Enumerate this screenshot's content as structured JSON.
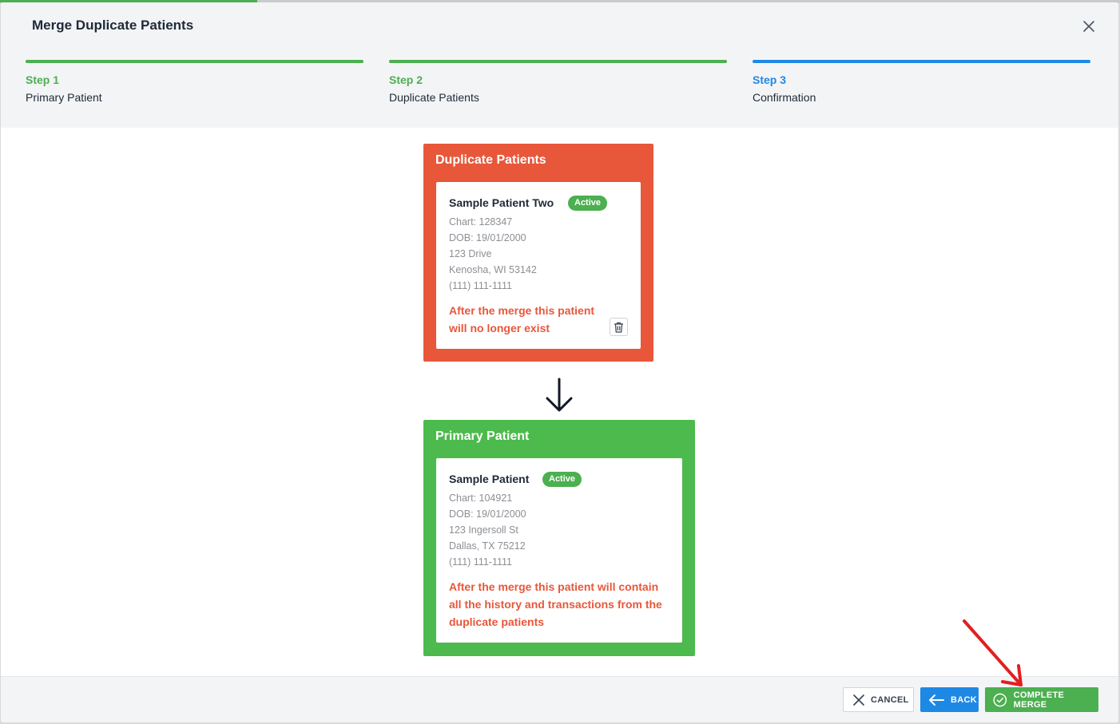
{
  "modal": {
    "title": "Merge Duplicate Patients"
  },
  "steps": [
    {
      "number": "Step 1",
      "name": "Primary Patient",
      "state": "done"
    },
    {
      "number": "Step 2",
      "name": "Duplicate Patients",
      "state": "done"
    },
    {
      "number": "Step 3",
      "name": "Confirmation",
      "state": "current"
    }
  ],
  "duplicate": {
    "heading": "Duplicate Patients",
    "patient": {
      "name": "Sample Patient Two",
      "status": "Active",
      "chart": "Chart: 128347",
      "dob": "DOB: 19/01/2000",
      "address1": "123 Drive",
      "address2": "Kenosha, WI 53142",
      "phone": "(111) 111-1111"
    },
    "warning": "After the merge this patient will no longer exist"
  },
  "primary": {
    "heading": "Primary Patient",
    "patient": {
      "name": "Sample Patient",
      "status": "Active",
      "chart": "Chart: 104921",
      "dob": "DOB: 19/01/2000",
      "address1": "123 Ingersoll St",
      "address2": "Dallas, TX 75212",
      "phone": "(111) 111-1111"
    },
    "warning": "After the merge this patient will contain all the history and transactions from the duplicate patients"
  },
  "footer": {
    "cancel_label": "CANCEL",
    "back_label": "BACK",
    "complete_label": "COMPLETE MERGE"
  },
  "colors": {
    "step_done": "#4caf50",
    "step_current": "#1e88e5",
    "duplicate_panel": "#e8573a",
    "primary_panel": "#4cba4c",
    "annotation_arrow": "#e02020"
  },
  "icons": {
    "close": "close-icon",
    "trash": "trash-icon",
    "merge_arrow": "arrow-down-icon",
    "cancel": "x-icon",
    "back": "arrow-left-icon",
    "complete": "check-circle-icon"
  }
}
